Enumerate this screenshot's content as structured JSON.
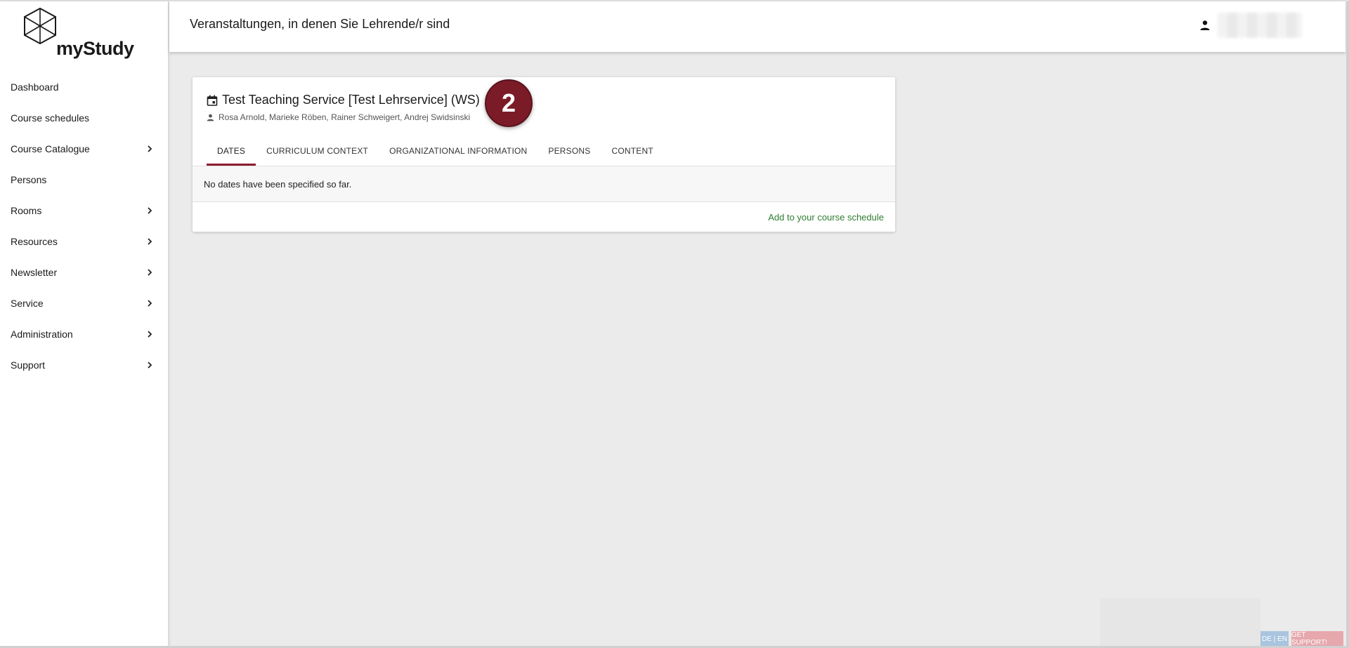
{
  "app": {
    "name": "myStudy"
  },
  "sidebar": {
    "items": [
      {
        "label": "Dashboard",
        "has_children": false
      },
      {
        "label": "Course schedules",
        "has_children": false
      },
      {
        "label": "Course Catalogue",
        "has_children": true
      },
      {
        "label": "Persons",
        "has_children": false
      },
      {
        "label": "Rooms",
        "has_children": true
      },
      {
        "label": "Resources",
        "has_children": true
      },
      {
        "label": "Newsletter",
        "has_children": true
      },
      {
        "label": "Service",
        "has_children": true
      },
      {
        "label": "Administration",
        "has_children": true
      },
      {
        "label": "Support",
        "has_children": true
      }
    ]
  },
  "header": {
    "title": "Veranstaltungen, in denen Sie Lehrende/r sind",
    "user_icon": "person-icon",
    "user_name": "████ ████"
  },
  "course": {
    "icon": "calendar-icon",
    "title": "Test Teaching Service [Test Lehrservice] (WS)",
    "persons_icon": "person-icon",
    "persons": "Rosa Arnold, Marieke Röben, Rainer Schweigert, Andrej Swidsinski",
    "badge": "2",
    "tabs": [
      {
        "label": "DATES",
        "active": true
      },
      {
        "label": "CURRICULUM CONTEXT",
        "active": false
      },
      {
        "label": "ORGANIZATIONAL INFORMATION",
        "active": false
      },
      {
        "label": "PERSONS",
        "active": false
      },
      {
        "label": "CONTENT",
        "active": false
      }
    ],
    "empty_message": "No dates have been specified so far.",
    "add_link": "Add to your course schedule"
  },
  "footer": {
    "lang_switch": "DE | EN",
    "support_button": "GET SUPPORT!"
  },
  "colors": {
    "accent": "#8b1d2c",
    "badge": "#7b1b28",
    "link": "#2e7d32",
    "lang_bg": "#a9c4de",
    "support_bg": "#e6a7ad"
  }
}
